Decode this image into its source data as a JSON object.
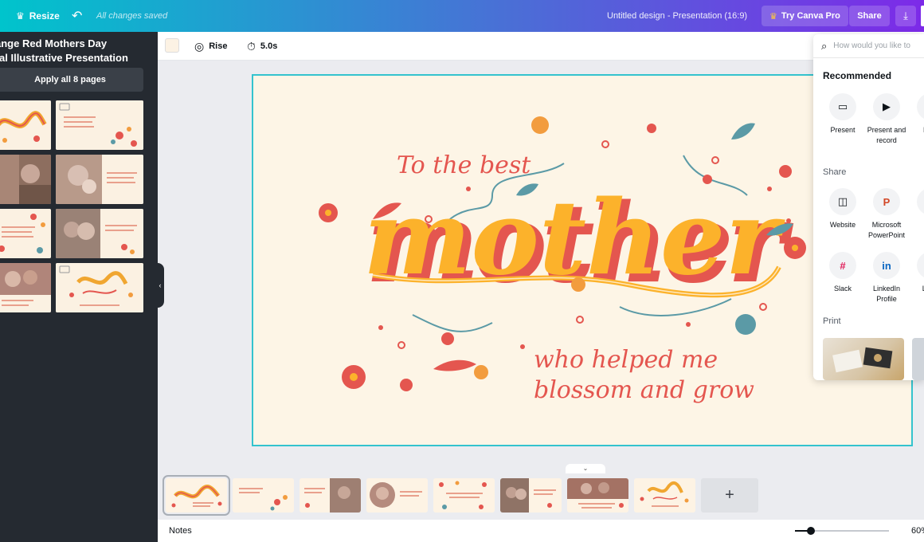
{
  "topbar": {
    "resize_label": "Resize",
    "saved_status": "All changes saved",
    "document_title": "Untitled design - Presentation (16:9)",
    "try_pro_label": "Try Canva Pro",
    "share_label": "Share"
  },
  "left_panel": {
    "template_title_line1": "ange Red Mothers Day",
    "template_title_line2": "ral Illustrative Presentation",
    "apply_button": "Apply all 8 pages"
  },
  "toolbar": {
    "animation_label": "Rise",
    "duration_label": "5.0s"
  },
  "slide": {
    "top_text": "To the best",
    "main_text": "mother",
    "bottom_line1": "who helped me",
    "bottom_line2": "blossom and grow"
  },
  "share_panel": {
    "search_placeholder": "How would you like to",
    "recommended_heading": "Recommended",
    "recommended": [
      {
        "label": "Present",
        "icon": "present-icon"
      },
      {
        "label": "Present and record",
        "icon": "record-icon"
      },
      {
        "label": "Dow",
        "icon": "download-icon"
      }
    ],
    "share_heading": "Share",
    "share_options": [
      {
        "label": "Website",
        "icon": "website-icon"
      },
      {
        "label": "Microsoft PowerPoint",
        "icon": "powerpoint-icon"
      },
      {
        "label": "Em",
        "icon": "email-icon"
      },
      {
        "label": "Slack",
        "icon": "slack-icon"
      },
      {
        "label": "LinkedIn Profile",
        "icon": "linkedin-icon"
      },
      {
        "label": "Lin P",
        "icon": "linkedin-page-icon"
      }
    ],
    "print_heading": "Print"
  },
  "bottombar": {
    "notes_label": "Notes",
    "zoom_label": "60%",
    "zoom_level": 0.17
  },
  "colors": {
    "accent_teal": "#00c4cc",
    "accent_purple": "#7d2ae8",
    "slide_border": "#34c3ce",
    "slide_bg": "#fdf5e6",
    "script_text": "#e4564f",
    "mother_yellow": "#fcb22b"
  }
}
